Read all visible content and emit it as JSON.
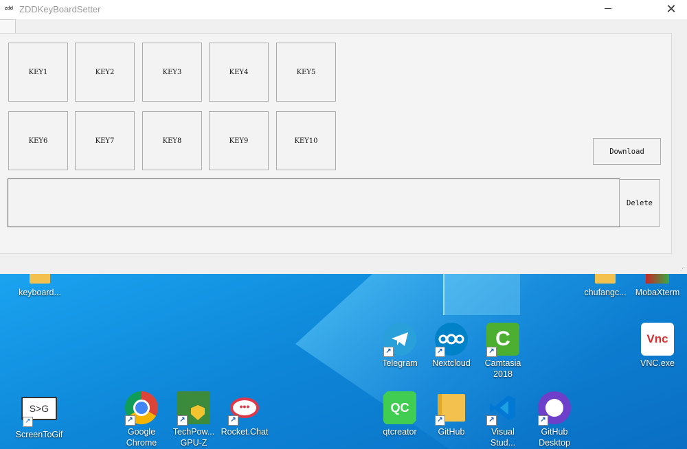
{
  "window": {
    "title": "ZDDKeyBoardSetter",
    "app_icon_text": "zdd",
    "close_glyph": "✕",
    "keys_row1": [
      "KEY1",
      "KEY2",
      "KEY3",
      "KEY4",
      "KEY5"
    ],
    "keys_row2": [
      "KEY6",
      "KEY7",
      "KEY8",
      "KEY9",
      "KEY10"
    ],
    "download_label": "Download",
    "delete_label": "Delete",
    "text_area_value": ""
  },
  "desktop": {
    "icons": [
      {
        "label": "keyboard...",
        "icon": "folder-icon",
        "color": "#f2c14e"
      },
      {
        "label": "chufangc...",
        "icon": "folder-icon",
        "color": "#f2c14e"
      },
      {
        "label": "MobaXterm",
        "icon": "mobaxterm-icon",
        "color": "#3aa845"
      },
      {
        "label": "Telegram",
        "icon": "telegram-icon",
        "color": "#2aa0da"
      },
      {
        "label": "Nextcloud",
        "icon": "nextcloud-icon",
        "color": "#0082c9"
      },
      {
        "label": "Camtasia\n2018",
        "icon": "camtasia-icon",
        "color": "#4caf32"
      },
      {
        "label": "VNC.exe",
        "icon": "vnc-icon",
        "color": "#ffffff"
      },
      {
        "label": "ScreenToGif",
        "icon": "screentogif-icon",
        "color": "#ffffff"
      },
      {
        "label": "Google\nChrome",
        "icon": "chrome-icon",
        "color": "#4285f4"
      },
      {
        "label": "TechPow...\nGPU-Z",
        "icon": "gpuz-icon",
        "color": "#3c8a3c"
      },
      {
        "label": "Rocket.Chat",
        "icon": "rocketchat-icon",
        "color": "#e0384b"
      },
      {
        "label": "qtcreator",
        "icon": "qtcreator-icon",
        "color": "#41cd52"
      },
      {
        "label": "GitHub",
        "icon": "folder-icon",
        "color": "#f2c14e"
      },
      {
        "label": "Visual\nStud...",
        "icon": "vscode-icon",
        "color": "#0078d4"
      },
      {
        "label": "GitHub\nDesktop",
        "icon": "github-desktop-icon",
        "color": "#6e40c9"
      }
    ],
    "glyph_texts": {
      "screentogif": "S>G",
      "qtcreator": "QC",
      "camtasia": "C",
      "vnc": "Vnc"
    }
  }
}
